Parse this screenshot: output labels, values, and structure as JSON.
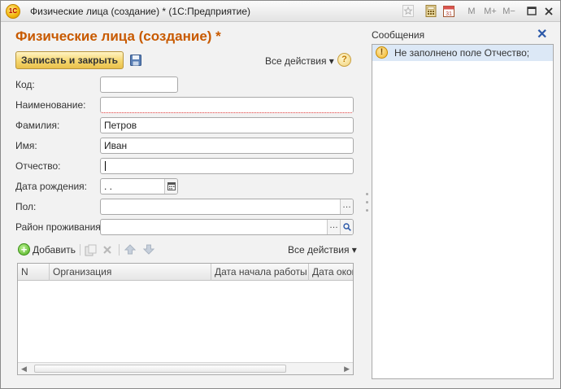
{
  "window": {
    "title": "Физические лица (создание) * (1С:Предприятие)",
    "logo_text": "1С",
    "buttons": {
      "m": "M",
      "m_plus": "M+",
      "m_minus": "M−"
    }
  },
  "form": {
    "title": "Физические лица (создание) *",
    "save_close_label": "Записать и закрыть",
    "all_actions_label": "Все действия ▾",
    "help_label": "?",
    "fields": {
      "code": {
        "label": "Код:",
        "value": ""
      },
      "name": {
        "label": "Наименование:",
        "value": ""
      },
      "surname": {
        "label": "Фамилия:",
        "value": "Петров"
      },
      "first_name": {
        "label": "Имя:",
        "value": "Иван"
      },
      "patronymic": {
        "label": "Отчество:",
        "value": ""
      },
      "birth_date": {
        "label": "Дата рождения:",
        "value": " .  .  "
      },
      "gender": {
        "label": "Пол:",
        "value": ""
      },
      "district": {
        "label": "Район проживания:",
        "value": ""
      }
    },
    "table_toolbar": {
      "add_label": "Добавить",
      "all_actions_label": "Все действия ▾"
    },
    "table": {
      "columns": [
        "N",
        "Организация",
        "Дата начала работы",
        "Дата окон"
      ],
      "rows": []
    }
  },
  "messages": {
    "title": "Сообщения",
    "items": [
      {
        "text": "Не заполнено поле Отчество;",
        "level": "warning"
      }
    ]
  },
  "colors": {
    "title_accent": "#c85a00",
    "primary_button": "#f5d66e",
    "message_highlight": "#dce8f6"
  }
}
